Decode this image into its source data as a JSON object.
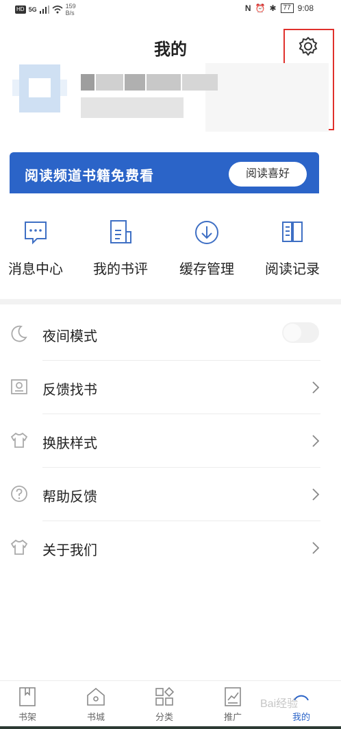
{
  "status_bar": {
    "hd": "HD",
    "signal": "5G",
    "speed_value": "159",
    "speed_unit": "B/s",
    "battery": "77",
    "time": "9:08"
  },
  "header": {
    "title": "我的",
    "settings_icon": "gear-icon"
  },
  "banner": {
    "text": "阅读频道书籍免费看",
    "button_label": "阅读喜好",
    "color": "#2b64c8"
  },
  "quick_actions": [
    {
      "label": "消息中心",
      "icon": "message-icon"
    },
    {
      "label": "我的书评",
      "icon": "book-review-icon"
    },
    {
      "label": "缓存管理",
      "icon": "download-icon"
    },
    {
      "label": "阅读记录",
      "icon": "open-book-icon"
    }
  ],
  "menu": [
    {
      "label": "夜间模式",
      "icon": "moon-icon",
      "control": "toggle",
      "toggle_on": false
    },
    {
      "label": "反馈找书",
      "icon": "search-book-icon",
      "control": "chevron"
    },
    {
      "label": "换肤样式",
      "icon": "shirt-icon",
      "control": "chevron"
    },
    {
      "label": "帮助反馈",
      "icon": "question-icon",
      "control": "chevron"
    },
    {
      "label": "关于我们",
      "icon": "shirt-icon",
      "control": "chevron"
    }
  ],
  "tabs": [
    {
      "label": "书架",
      "icon": "bookshelf-icon",
      "active": false
    },
    {
      "label": "书城",
      "icon": "store-icon",
      "active": false
    },
    {
      "label": "分类",
      "icon": "category-icon",
      "active": false
    },
    {
      "label": "推广",
      "icon": "chart-icon",
      "active": false
    },
    {
      "label": "我的",
      "icon": "profile-icon",
      "active": true
    }
  ],
  "watermark": "Bai经验",
  "colors": {
    "accent": "#2b64c8",
    "highlight": "#e0302b",
    "icon_blue": "#3e6fc4"
  }
}
